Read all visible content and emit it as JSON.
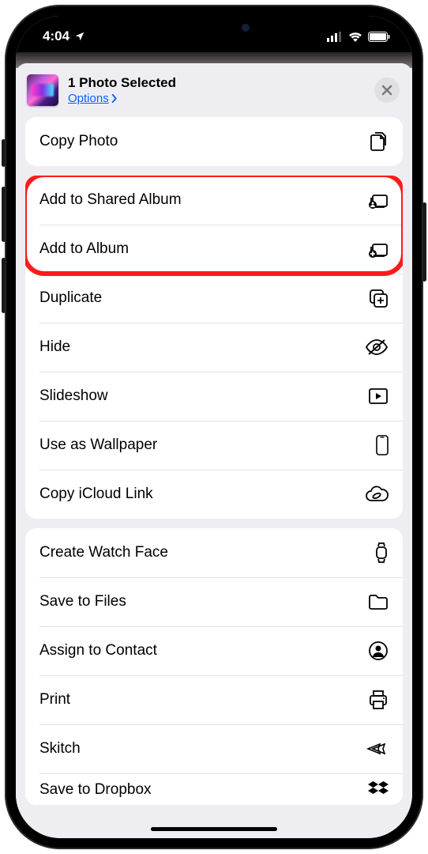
{
  "status": {
    "time": "4:04"
  },
  "header": {
    "title": "1 Photo Selected",
    "options_label": "Options"
  },
  "group1": {
    "copy_photo": "Copy Photo"
  },
  "group2": {
    "add_shared": "Add to Shared Album",
    "add_album": "Add to Album",
    "duplicate": "Duplicate",
    "hide": "Hide",
    "slideshow": "Slideshow",
    "wallpaper": "Use as Wallpaper",
    "icloud_link": "Copy iCloud Link"
  },
  "group3": {
    "watch_face": "Create Watch Face",
    "save_files": "Save to Files",
    "assign_contact": "Assign to Contact",
    "print": "Print",
    "skitch": "Skitch",
    "dropbox": "Save to Dropbox"
  }
}
